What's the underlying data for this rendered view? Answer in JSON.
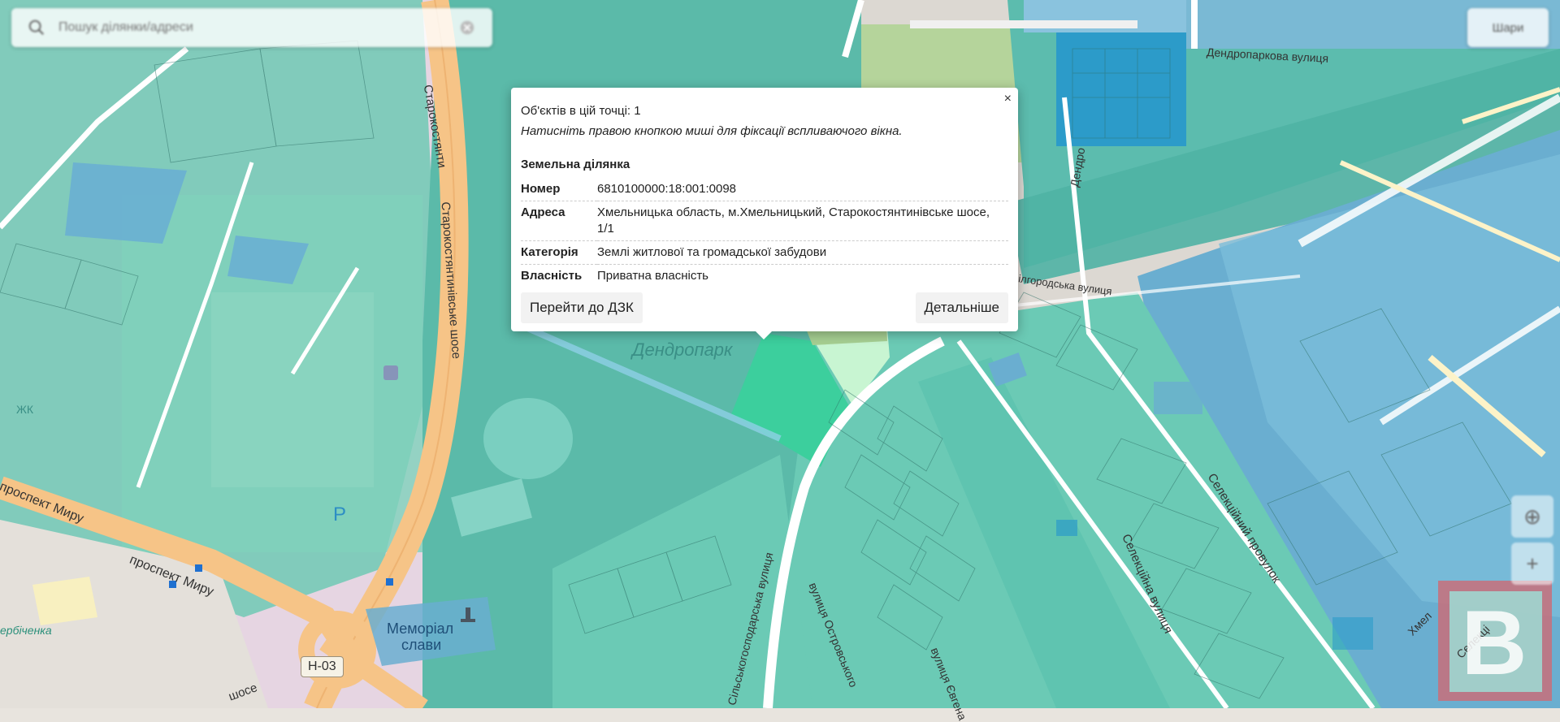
{
  "search": {
    "placeholder": "Пошук ділянки/адреси"
  },
  "top_right": {
    "label": "Шари"
  },
  "map_labels": {
    "dendroparkova_street": "Дендропаркова вулиця",
    "starokostiantyniv_short": "Старокостянти",
    "starokostiantyniv_shose": "Старокостянтинівське шосе",
    "dendropark": "Дендропарк",
    "prospekt_myru_1": "проспект Миру",
    "prospekt_myru_2": "проспект Миру",
    "road_h03": "Н-03",
    "memorial_line1": "Меморіал",
    "memorial_line2": "слави",
    "bilhorodska": "Білгородська вулиця",
    "selektsiinyi_prov": "Селекційний провулок",
    "selektsiina_vul": "Селекційна вулиця",
    "silskohosp_vul": "Сільськогосподарська вулиця",
    "ostrovskoho": "вулиця Островського",
    "yevhena": "вулиця Євгена",
    "dendro_vertical": "Дендро",
    "zhk": "ЖК",
    "herbichenka": "ербіченка",
    "shose_bottom": "шосе",
    "khmel_right": "Хмел",
    "selekts_right": "Селекці",
    "parking": "P"
  },
  "popup": {
    "close_symbol": "×",
    "objects_count": "Об'єктів в цій точці: 1",
    "hint": "Натисніть правою кнопкою миші для фіксації вспливаючого вікна.",
    "object_type": "Земельна ділянка",
    "rows": [
      {
        "key": "Номер",
        "value": "6810100000:18:001:0098"
      },
      {
        "key": "Адреса",
        "value": "Хмельницька область, м.Хмельницький, Старокостянтинівське шосе, 1/1"
      },
      {
        "key": "Категорія",
        "value": "Землі житлової та громадської забудови"
      },
      {
        "key": "Власність",
        "value": "Приватна власність"
      }
    ],
    "btn_dzk": "Перейти до ДЗК",
    "btn_details": "Детальніше"
  },
  "controls": {
    "locate_symbol": "⊕",
    "zoom_symbol": "+"
  },
  "logo": {
    "letter": "B"
  },
  "colors": {
    "parcel_teal": "#5fc4b0",
    "parcel_blue": "#6aaed0",
    "parcel_dark_blue": "#2c9bc9",
    "highlight_green": "#3ccf9d",
    "road_orange": "#f6c487",
    "park_green": "#b5d49b"
  }
}
